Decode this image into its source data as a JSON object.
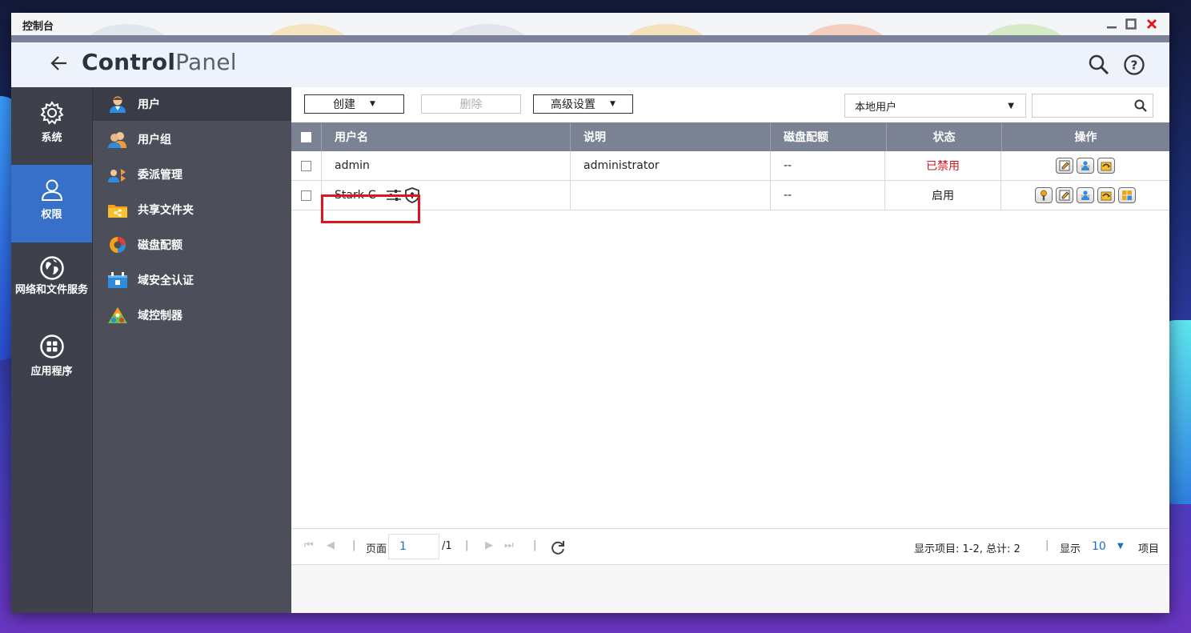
{
  "window": {
    "title": "控制台",
    "brand_bold": "Control",
    "brand_light": "Panel"
  },
  "leftnav": [
    {
      "label": "系统",
      "icon": "gear-icon"
    },
    {
      "label": "权限",
      "icon": "user-outline-icon",
      "active": true
    },
    {
      "label": "网络和文件服务",
      "icon": "globe-icon"
    },
    {
      "label": "应用程序",
      "icon": "apps-grid-icon"
    }
  ],
  "subnav": [
    {
      "label": "用户",
      "icon": "user-icon",
      "active": true
    },
    {
      "label": "用户组",
      "icon": "user-group-icon"
    },
    {
      "label": "委派管理",
      "icon": "delegate-icon"
    },
    {
      "label": "共享文件夹",
      "icon": "shared-folder-icon"
    },
    {
      "label": "磁盘配额",
      "icon": "disk-quota-icon"
    },
    {
      "label": "域安全认证",
      "icon": "domain-security-icon"
    },
    {
      "label": "域控制器",
      "icon": "domain-controller-icon"
    }
  ],
  "toolbar": {
    "create_label": "创建",
    "delete_label": "删除",
    "advanced_label": "高级设置",
    "user_type_selected": "本地用户",
    "search_placeholder": ""
  },
  "table": {
    "columns": [
      "用户名",
      "说明",
      "磁盘配额",
      "状态",
      "操作"
    ],
    "rows": [
      {
        "username": "admin",
        "description": "administrator",
        "quota": "--",
        "status": "已禁用",
        "status_color": "#d0141e",
        "actions": [
          "edit-profile-icon",
          "edit-group-icon",
          "edit-permission-icon"
        ]
      },
      {
        "username": "Stark-C",
        "description": "",
        "quota": "--",
        "status": "启用",
        "status_color": "#222222",
        "actions": [
          "password-key-icon",
          "edit-profile-icon",
          "edit-group-icon",
          "edit-permission-icon",
          "app-permission-icon"
        ]
      }
    ]
  },
  "pager": {
    "page_label": "页面",
    "current_page": "1",
    "total_pages": "/1",
    "display_items": "显示项目: 1-2, 总计: 2",
    "show_label": "显示",
    "per_page": "10",
    "items_label": "项目"
  },
  "colors": {
    "accent": "#3770c9",
    "highlight": "#e0141e",
    "header_bg": "#7a8294"
  }
}
